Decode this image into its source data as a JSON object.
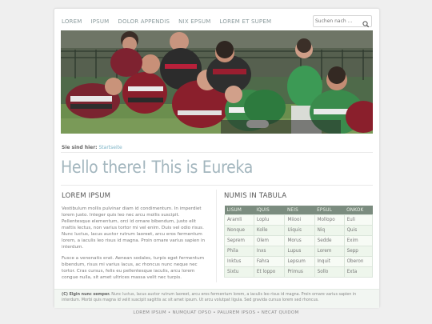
{
  "nav": {
    "items": [
      "LOREM",
      "IPSUM",
      "DOLOR APPENDIS",
      "NIX EPSUM",
      "LOREM ET SUPEM"
    ]
  },
  "search": {
    "placeholder": "Suchen nach ...",
    "icon": "search-icon"
  },
  "hero": {
    "description_icon": "rugby-photo"
  },
  "breadcrumb": {
    "label": "Sie sind hier:",
    "link": "Startseite"
  },
  "page_title": "Hello there! This is Eureka",
  "lorem": {
    "heading": "LOREM IPSUM",
    "paragraphs": [
      "Vestibulum mollis pulvinar diam id condimentum. In imperdiet lorem justo. Integer quis leo nec arcu mollis suscipit. Pellentesque elementum, orci id ornare bibendum, justo elit mattis lectus, non varius tortor mi vel enim. Duis vel odio risus. Nunc luctus, lacus auctor rutrum laoreet, arcu eros fermentum lorem, a iaculis leo risus id magna. Proin ornare varius sapien in interdum.",
      "Fusce a venenatis erat. Aenean sodales, turpis eget fermentum bibendum, risus mi varius lacus, ac rhoncus nunc neque nec tortor. Cras cursus, felis eu pellentesque iaculis, arcu lorem congue nulla, sit amet ultrices massa velit nec turpis."
    ]
  },
  "table": {
    "heading": "NUMIS IN TABULA",
    "columns": [
      "LISUM",
      "IQUIS",
      "NEIS",
      "EPSUL",
      "ONKOK"
    ],
    "rows": [
      [
        "Aramli",
        "Loplu",
        "Miiooi",
        "Mollopo",
        "Euli"
      ],
      [
        "Nonque",
        "Kolle",
        "Uiquis",
        "Niq",
        "Quis"
      ],
      [
        "Seprem",
        "Olem",
        "Morus",
        "Sedde",
        "Exim"
      ],
      [
        "Phila",
        "Inxs",
        "Lupus",
        "Lorem",
        "Sepp"
      ],
      [
        "Inktus",
        "Fahra",
        "Lepsum",
        "Inquit",
        "Oberon"
      ],
      [
        "Sixtu",
        "Et loppo",
        "Primus",
        "Sollo",
        "Exta"
      ]
    ]
  },
  "footnote": {
    "bold": "(C) Elgin nunc semper.",
    "text": " Nunc luctus, lacus auctor rutrum laoreet, arcu eros fermentum lorem, a iaculis leo risus id magna. Proin ornare varius sapien in interdum. Morbi quis magna id velit suscipit sagittis ac sit amet ipsum. Ut arcu volutpat ligula. Sed gravida cursus lorem sed rhoncus."
  },
  "bottom_links": [
    "LOREM IPSUM",
    "NUMQUAT OPSO",
    "PALUREM IPSOS",
    "NECAT QUIDOM"
  ],
  "bottom_sep": "•"
}
